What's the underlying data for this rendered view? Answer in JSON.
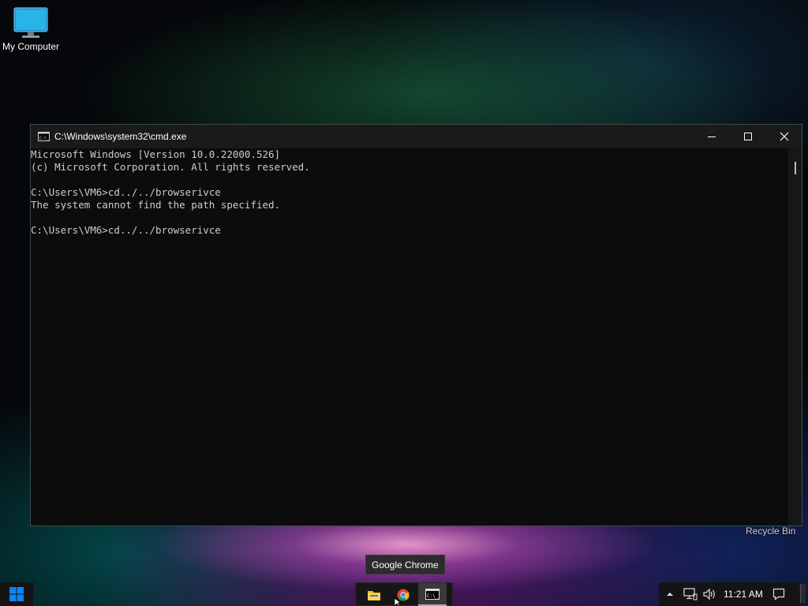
{
  "desktop": {
    "icons": [
      {
        "label": "My Computer",
        "icon": "monitor-icon"
      }
    ],
    "recycle_bin_label": "Recycle Bin"
  },
  "cmd_window": {
    "title": "C:\\Windows\\system32\\cmd.exe",
    "lines": [
      "Microsoft Windows [Version 10.0.22000.526]",
      "(c) Microsoft Corporation. All rights reserved.",
      "",
      "C:\\Users\\VM6>cd../../browserivce",
      "The system cannot find the path specified.",
      "",
      "C:\\Users\\VM6>cd../../browserivce"
    ],
    "colors": {
      "background": "#0c0c0c",
      "text": "#cccccc",
      "titlebar": "#1a1a1a"
    }
  },
  "tooltip": {
    "text": "Google Chrome"
  },
  "taskbar": {
    "start_icon": "windows-logo-icon",
    "apps": [
      {
        "name": "File Explorer",
        "icon": "folder-icon"
      },
      {
        "name": "Google Chrome",
        "icon": "chrome-icon"
      },
      {
        "name": "Command Prompt",
        "icon": "cmd-icon",
        "active": true
      }
    ],
    "tray": {
      "icons": [
        "chevron-up-icon",
        "network-icon",
        "volume-icon",
        "notification-icon"
      ],
      "clock": "11:21 AM"
    }
  }
}
